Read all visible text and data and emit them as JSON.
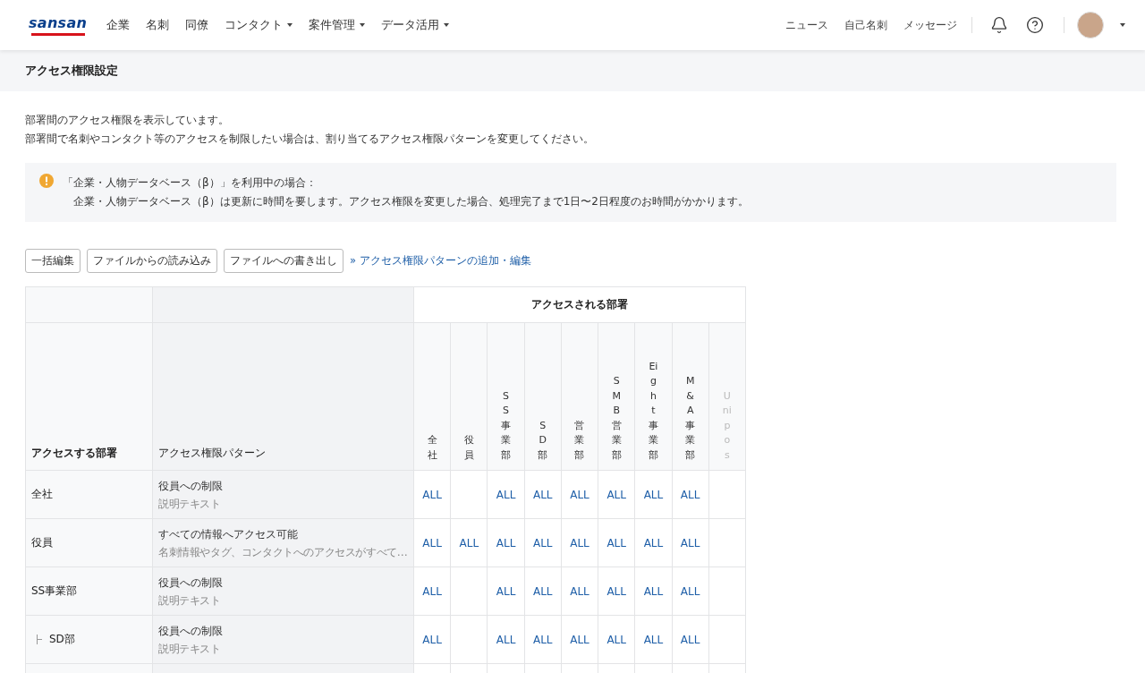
{
  "header": {
    "logo": "sansan",
    "nav": [
      {
        "label": "企業",
        "dropdown": false
      },
      {
        "label": "名刺",
        "dropdown": false
      },
      {
        "label": "同僚",
        "dropdown": false
      },
      {
        "label": "コンタクト",
        "dropdown": true
      },
      {
        "label": "案件管理",
        "dropdown": true
      },
      {
        "label": "データ活用",
        "dropdown": true
      }
    ],
    "right_links": [
      "ニュース",
      "自己名刺",
      "メッセージ"
    ]
  },
  "page_title": "アクセス権限設定",
  "intro": [
    "部署間のアクセス権限を表示しています。",
    "部署間で名刺やコンタクト等のアクセスを制限したい場合は、割り当てるアクセス権限パターンを変更してください。"
  ],
  "notice": {
    "title": "「企業・人物データベース（β）」を利用中の場合：",
    "body": "企業・人物データベース（β）は更新に時間を要します。アクセス権限を変更した場合、処理完了まで1日〜2日程度のお時間がかかります。"
  },
  "actions": {
    "buttons": [
      "一括編集",
      "ファイルからの読み込み",
      "ファイルへの書き出し"
    ],
    "link": "» アクセス権限パターンの追加・編集"
  },
  "table": {
    "group_header": "アクセスされる部署",
    "col_department": "アクセスする部署",
    "col_pattern": "アクセス権限パターン",
    "columns": [
      {
        "name": "全社",
        "disabled": false
      },
      {
        "name": "役員",
        "disabled": false
      },
      {
        "name": "SS事業部",
        "disabled": false
      },
      {
        "name": "SD部",
        "disabled": false
      },
      {
        "name": "営業部",
        "disabled": false
      },
      {
        "name": "SMB営業部",
        "disabled": false
      },
      {
        "name": "Eight事業部",
        "disabled": false
      },
      {
        "name": "M&A事業部",
        "disabled": false
      },
      {
        "name": "Unipos",
        "disabled": true
      }
    ],
    "rows": [
      {
        "department": "全社",
        "pattern": "役員への制限",
        "description": "説明テキスト",
        "access": [
          {
            "granted": true,
            "label": "ALL"
          },
          {
            "granted": false
          },
          {
            "granted": true,
            "label": "ALL"
          },
          {
            "granted": true,
            "label": "ALL"
          },
          {
            "granted": true,
            "label": "ALL"
          },
          {
            "granted": true,
            "label": "ALL"
          },
          {
            "granted": true,
            "label": "ALL"
          },
          {
            "granted": true,
            "label": "ALL"
          },
          {
            "granted": false
          }
        ]
      },
      {
        "department": "役員",
        "pattern": "すべての情報へアクセス可能",
        "description": "名刺情報やタグ、コンタクトへのアクセスがすべて…",
        "access": [
          {
            "granted": true,
            "label": "ALL"
          },
          {
            "granted": true,
            "label": "ALL"
          },
          {
            "granted": true,
            "label": "ALL"
          },
          {
            "granted": true,
            "label": "ALL"
          },
          {
            "granted": true,
            "label": "ALL"
          },
          {
            "granted": true,
            "label": "ALL"
          },
          {
            "granted": true,
            "label": "ALL"
          },
          {
            "granted": true,
            "label": "ALL"
          },
          {
            "granted": false
          }
        ]
      },
      {
        "department": "SS事業部",
        "pattern": "役員への制限",
        "description": "説明テキスト",
        "access": [
          {
            "granted": true,
            "label": "ALL"
          },
          {
            "granted": false
          },
          {
            "granted": true,
            "label": "ALL"
          },
          {
            "granted": true,
            "label": "ALL"
          },
          {
            "granted": true,
            "label": "ALL"
          },
          {
            "granted": true,
            "label": "ALL"
          },
          {
            "granted": true,
            "label": "ALL"
          },
          {
            "granted": true,
            "label": "ALL"
          },
          {
            "granted": false
          }
        ],
        "children": [
          {
            "department": "SD部",
            "pattern": "役員への制限",
            "description": "説明テキスト",
            "access": [
              {
                "granted": true,
                "label": "ALL"
              },
              {
                "granted": false
              },
              {
                "granted": true,
                "label": "ALL"
              },
              {
                "granted": true,
                "label": "ALL"
              },
              {
                "granted": true,
                "label": "ALL"
              },
              {
                "granted": true,
                "label": "ALL"
              },
              {
                "granted": true,
                "label": "ALL"
              },
              {
                "granted": true,
                "label": "ALL"
              },
              {
                "granted": false
              }
            ]
          }
        ]
      }
    ]
  }
}
